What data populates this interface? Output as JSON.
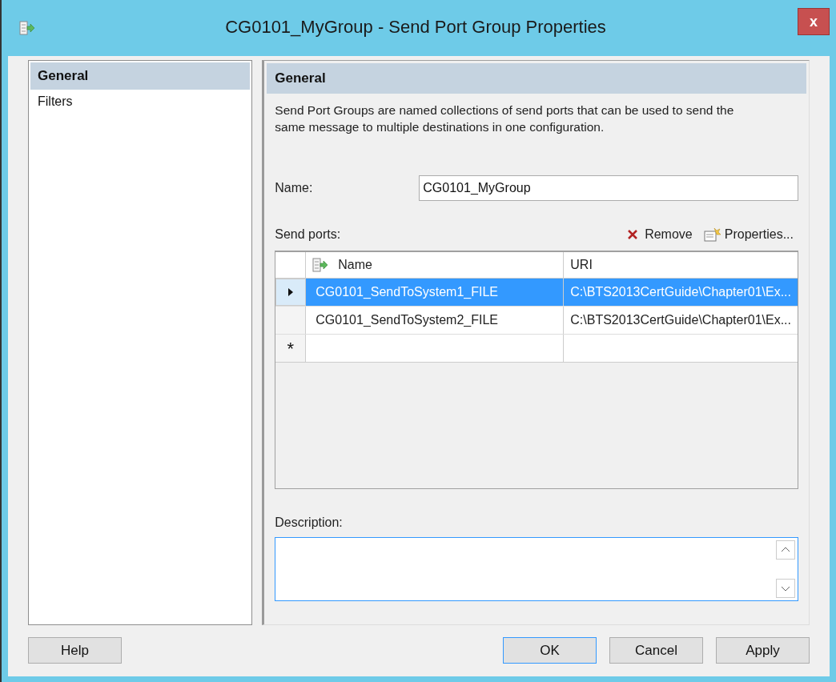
{
  "window": {
    "title": "CG0101_MyGroup - Send Port Group Properties",
    "close": "x"
  },
  "sidebar": {
    "items": [
      {
        "label": "General",
        "selected": true
      },
      {
        "label": "Filters",
        "selected": false
      }
    ]
  },
  "panel": {
    "heading": "General",
    "description": "Send Port Groups are named collections of send ports that can be used to send the same message to multiple destinations in one configuration.",
    "name_label": "Name:",
    "name_value": "CG0101_MyGroup",
    "send_ports_label": "Send ports:",
    "remove": "Remove",
    "properties": "Properties...",
    "table": {
      "columns": [
        "Name",
        "URI"
      ],
      "rows": [
        {
          "name": "CG0101_SendToSystem1_FILE",
          "uri": "C:\\BTS2013CertGuide\\Chapter01\\Ex...",
          "selected": true
        },
        {
          "name": "CG0101_SendToSystem2_FILE",
          "uri": "C:\\BTS2013CertGuide\\Chapter01\\Ex...",
          "selected": false
        }
      ],
      "new_row_marker": "*"
    },
    "description_label": "Description:"
  },
  "buttons": [
    {
      "label": "Help",
      "default": false
    },
    {
      "label": "OK",
      "default": true
    },
    {
      "label": "Cancel",
      "default": false
    },
    {
      "label": "Apply",
      "default": false
    }
  ]
}
